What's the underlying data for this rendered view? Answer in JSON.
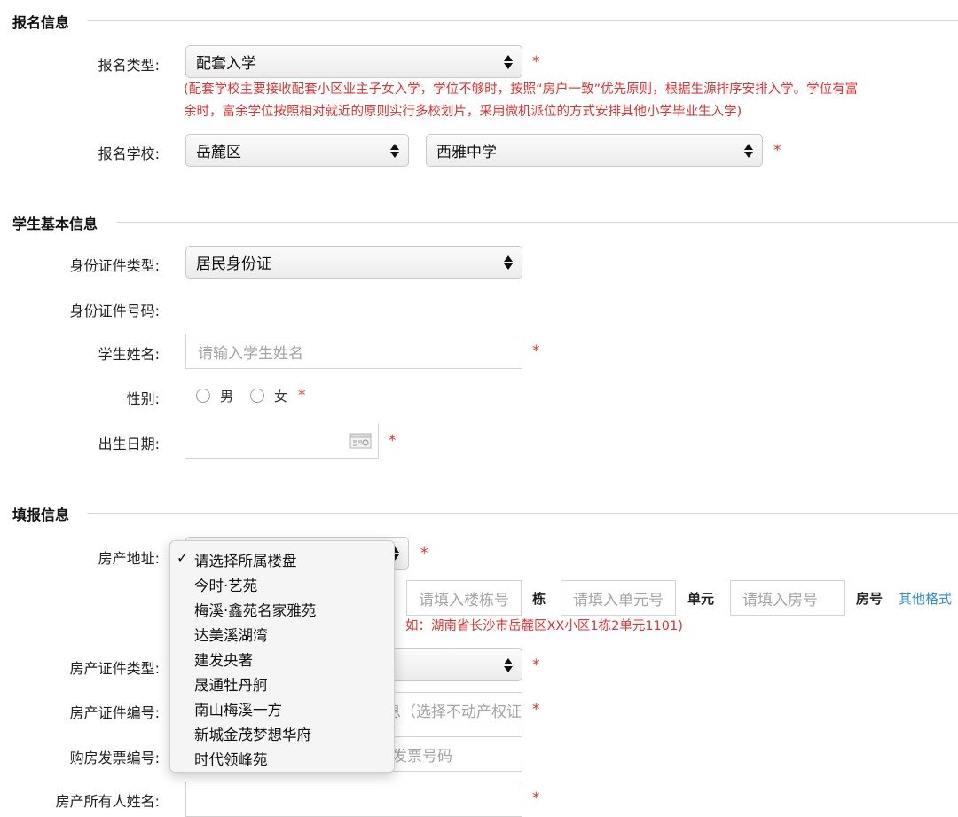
{
  "sections": {
    "registration": "报名信息",
    "student": "学生基本信息",
    "fill": "填报信息"
  },
  "registration": {
    "type_label": "报名类型:",
    "type_value": "配套入学",
    "note_line1": "(配套学校主要接收配套小区业主子女入学，学位不够时，按照“房户一致”优先原则，根据生源排序安排入学。学位有富",
    "note_line2": "余时，富余学位按照相对就近的原则实行多校划片，采用微机派位的方式安排其他小学毕业生入学)",
    "school_label": "报名学校:",
    "district_value": "岳麓区",
    "school_value": "西雅中学"
  },
  "student": {
    "id_type_label": "身份证件类型:",
    "id_type_value": "居民身份证",
    "id_number_label": "身份证件号码:",
    "name_label": "学生姓名:",
    "name_placeholder": "请输入学生姓名",
    "gender_label": "性别:",
    "gender_male": "男",
    "gender_female": "女",
    "birth_label": "出生日期:"
  },
  "fill": {
    "address_label": "房产地址:",
    "building_placeholder": "请填入楼栋号",
    "building_suffix": "栋",
    "unit_placeholder": "请填入单元号",
    "unit_suffix": "单元",
    "room_placeholder": "请填入房号",
    "room_suffix": "房号",
    "other_format_link": "其他格式",
    "address_example": "如：湖南省长沙市岳麓区XX小区1栋2单元1101)",
    "cert_type_label": "房产证件类型:",
    "cert_number_label": "房产证件编号:",
    "cert_number_placeholder_visible": "息（选择不动产权证",
    "invoice_label": "购房发票编号:",
    "invoice_placeholder_visible": "发票号码",
    "owner_label": "房产所有人姓名:"
  },
  "required_mark": "*",
  "estate_dropdown": {
    "selected_index": 0,
    "options": [
      "请选择所属楼盘",
      "今时·艺苑",
      "梅溪·鑫苑名家雅苑",
      "达美溪湖湾",
      "建发央著",
      "晟通牡丹舸",
      "南山梅溪一方",
      "新城金茂梦想华府",
      "时代领峰苑"
    ]
  },
  "icons": {
    "select_arrows": "updown-chevron-icon",
    "calendar": "calendar-icon",
    "checkmark": "checkmark-icon"
  },
  "colors": {
    "required": "#e0322f",
    "link": "#2c8fd6",
    "placeholder": "#a4a4a4"
  }
}
